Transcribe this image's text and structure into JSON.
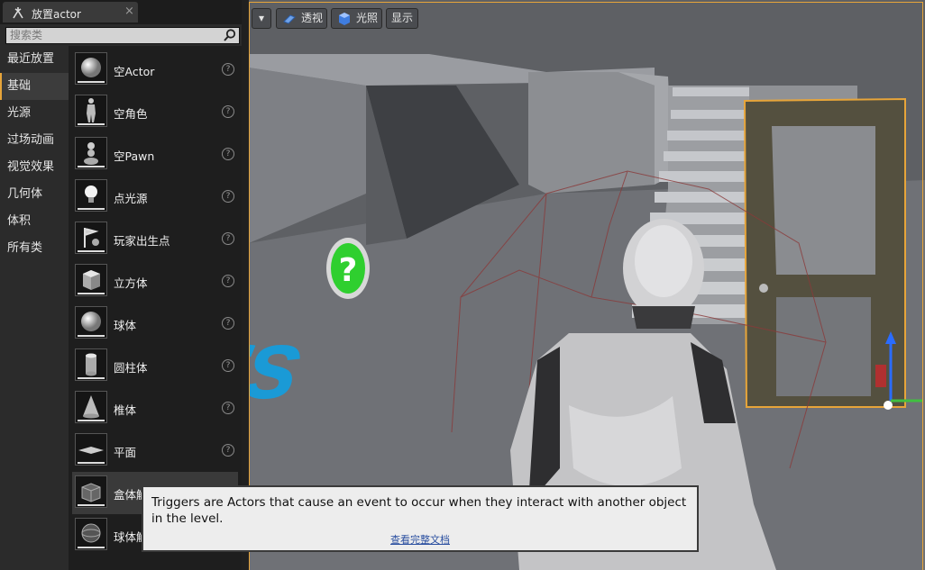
{
  "tab": {
    "title": "放置actor",
    "close": "×"
  },
  "search": {
    "placeholder": "搜索类"
  },
  "categories": [
    "最近放置",
    "基础",
    "光源",
    "过场动画",
    "视觉效果",
    "几何体",
    "体积",
    "所有类"
  ],
  "selected_category": "基础",
  "items": [
    {
      "label": "空Actor",
      "icon": "sphere-icon"
    },
    {
      "label": "空角色",
      "icon": "character-icon"
    },
    {
      "label": "空Pawn",
      "icon": "pawn-icon"
    },
    {
      "label": "点光源",
      "icon": "lightbulb-icon"
    },
    {
      "label": "玩家出生点",
      "icon": "player-start-icon"
    },
    {
      "label": "立方体",
      "icon": "cube-icon"
    },
    {
      "label": "球体",
      "icon": "sphere-icon"
    },
    {
      "label": "圆柱体",
      "icon": "cylinder-icon"
    },
    {
      "label": "椎体",
      "icon": "cone-icon"
    },
    {
      "label": "平面",
      "icon": "plane-icon"
    },
    {
      "label": "盒体触发器",
      "icon": "box-trigger-icon"
    },
    {
      "label": "球体触发器",
      "icon": "sphere-trigger-icon"
    }
  ],
  "help_glyph": "?",
  "viewport_toolbar": {
    "menu": "▾",
    "perspective": "透视",
    "lit": "光照",
    "show": "显示"
  },
  "viewport_floor_text": "ers",
  "tooltip": {
    "text": "Triggers are Actors that cause an event to occur when they interact with another object in the level.",
    "link": "查看完整文档"
  },
  "colors": {
    "accent": "#e7a53a",
    "floor_text": "#1a9ad6",
    "help_icon": "#2fcf2f"
  }
}
